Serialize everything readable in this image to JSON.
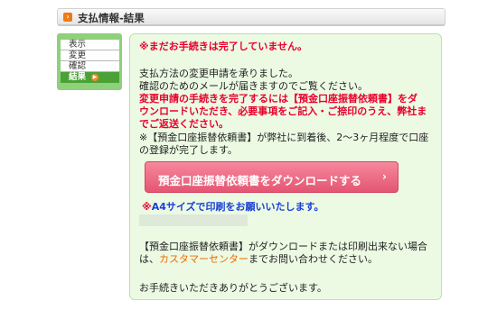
{
  "header": {
    "icon": "arrow-right-icon",
    "title": "支払情報-結果"
  },
  "steps": [
    {
      "label": "表示"
    },
    {
      "label": "変更"
    },
    {
      "label": "確認"
    },
    {
      "label": "結果"
    }
  ],
  "content": {
    "warning": "※まだお手続きは完了していません。",
    "intro_line1": "支払方法の変更申請を承りました。",
    "intro_line2": "確認のためのメールが届きますのでご覧ください。",
    "notice_line1": "変更申請の手続きを完了するには【預金口座振替依頼書】をダ",
    "notice_line2": "ウンロードいただき、必要事項をご記入・ご捺印のうえ、弊社ま",
    "notice_line3": "でご返送ください。",
    "info_line1": "※【預金口座振替依頼書】が弊社に到着後、2～3ヶ月程度で口座",
    "info_line2": "の登録が完了します。",
    "download_button": "預金口座振替依頼書をダウンロードする",
    "download_chevron": "›",
    "a4_note_mark": "※",
    "a4_note": "A4サイズで印刷をお願いいたします。",
    "trouble_line1": "【預金口座振替依頼書】がダウンロードまたは印刷出来ない場合",
    "trouble_pre": "は、",
    "customer_center": "カスタマーセンター",
    "trouble_post": "までお問い合わせください。",
    "thanks": "お手続きいただきありがとうございます。"
  },
  "colors": {
    "accent_red": "#e8002d",
    "nav_green": "#4aa236",
    "link_orange": "#f06b00",
    "button_pink": "#e45673"
  }
}
